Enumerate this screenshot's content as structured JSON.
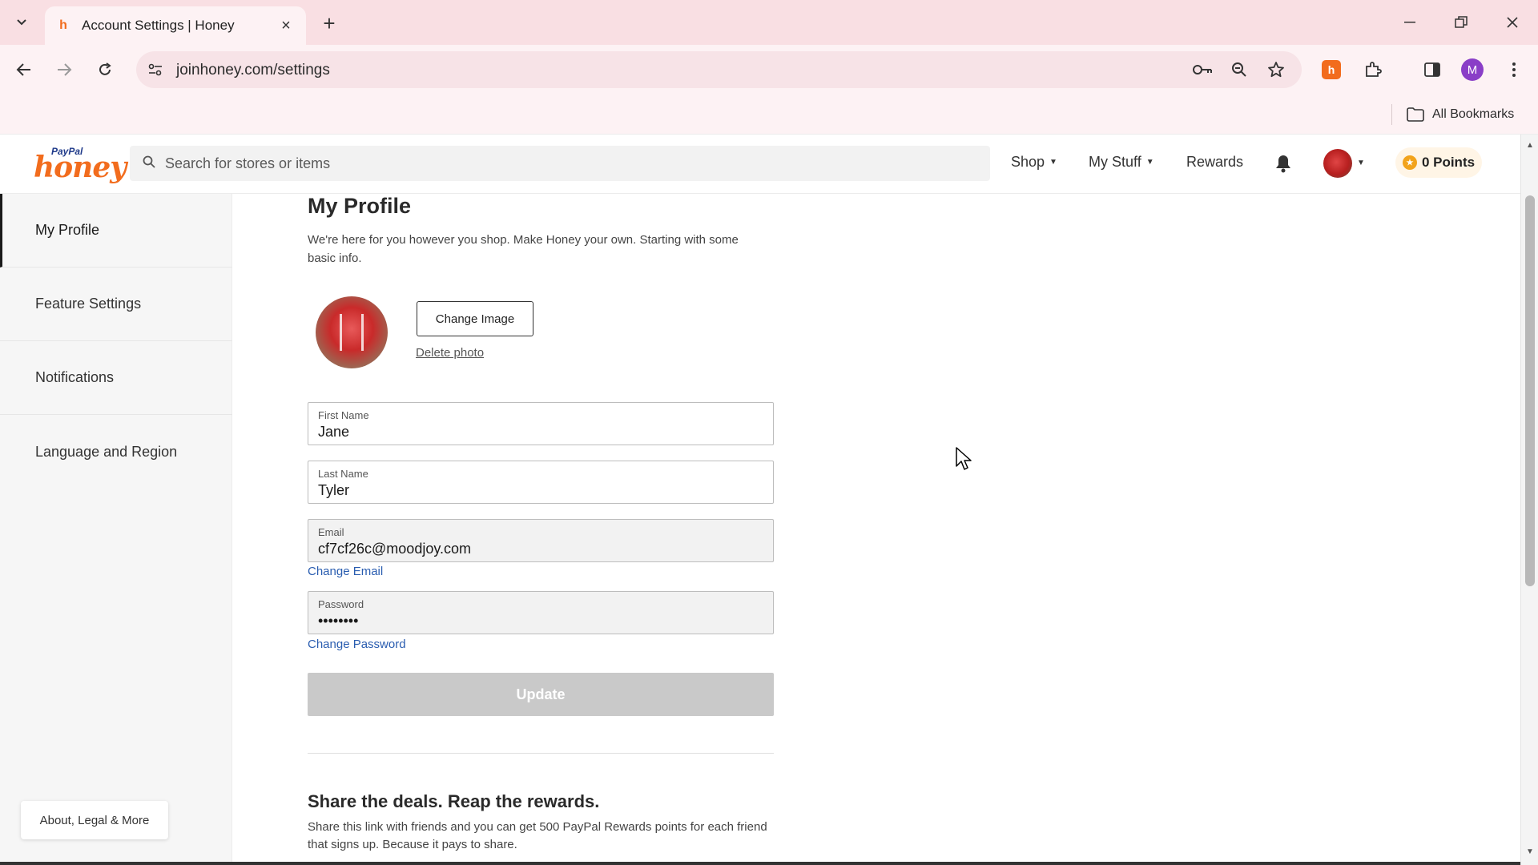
{
  "browser": {
    "tab_title": "Account Settings | Honey",
    "url": "joinhoney.com/settings",
    "all_bookmarks_label": "All Bookmarks",
    "profile_initial": "M"
  },
  "header": {
    "logo_paypal": "PayPal",
    "logo_honey": "honey",
    "search_placeholder": "Search for stores or items",
    "nav": {
      "shop": "Shop",
      "my_stuff": "My Stuff",
      "rewards": "Rewards"
    },
    "points_label": "0 Points"
  },
  "sidebar": {
    "items": [
      {
        "label": "My Profile"
      },
      {
        "label": "Feature Settings"
      },
      {
        "label": "Notifications"
      },
      {
        "label": "Language and Region"
      }
    ],
    "about_label": "About, Legal & More"
  },
  "profile": {
    "title": "My Profile",
    "intro": "We're here for you however you shop. Make Honey your own. Starting with some basic info.",
    "change_image_label": "Change Image",
    "delete_photo_label": "Delete photo",
    "fields": {
      "first_name": {
        "label": "First Name",
        "value": "Jane"
      },
      "last_name": {
        "label": "Last Name",
        "value": "Tyler"
      },
      "email": {
        "label": "Email",
        "value": "cf7cf26c@moodjoy.com"
      },
      "password": {
        "label": "Password",
        "value": "••••••••"
      }
    },
    "change_email_label": "Change Email",
    "change_password_label": "Change Password",
    "update_label": "Update"
  },
  "share": {
    "title": "Share the deals. Reap the rewards.",
    "text": "Share this link with friends and you can get 500 PayPal Rewards points for each friend that signs up. Because it pays to share."
  },
  "colors": {
    "brand_orange": "#f26c1d",
    "link_blue": "#2a5db0",
    "tabstrip_pink": "#f9dfe3"
  }
}
